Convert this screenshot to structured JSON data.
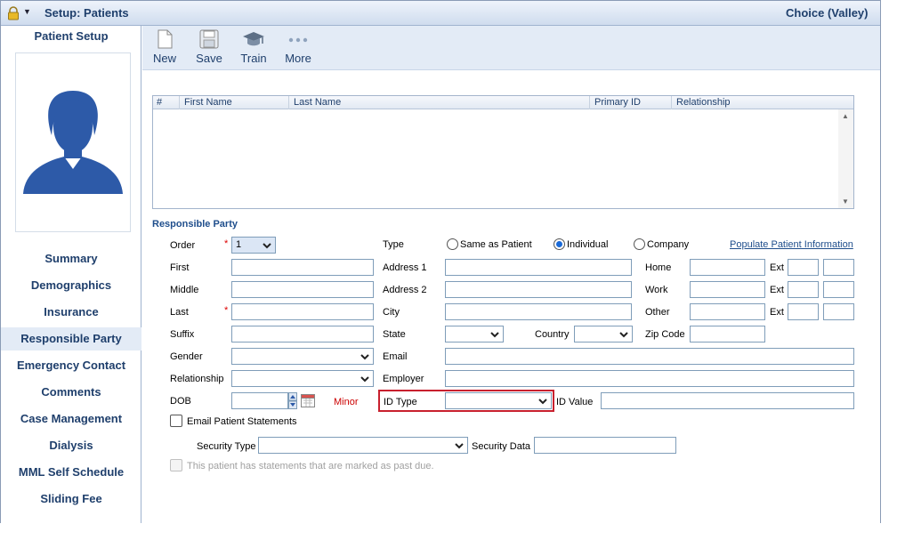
{
  "titlebar": {
    "title": "Setup: Patients",
    "org": "Choice (Valley)"
  },
  "sidebar": {
    "title": "Patient Setup",
    "items": [
      {
        "label": "Summary"
      },
      {
        "label": "Demographics"
      },
      {
        "label": "Insurance"
      },
      {
        "label": "Responsible Party",
        "active": true
      },
      {
        "label": "Emergency Contact"
      },
      {
        "label": "Comments"
      },
      {
        "label": "Case Management"
      },
      {
        "label": "Dialysis"
      },
      {
        "label": "MML Self Schedule"
      },
      {
        "label": "Sliding Fee"
      }
    ]
  },
  "toolbar": {
    "new": "New",
    "save": "Save",
    "train": "Train",
    "more": "More"
  },
  "grid": {
    "columns": [
      "#",
      "First Name",
      "Last Name",
      "Primary ID",
      "Relationship"
    ],
    "rows": []
  },
  "form": {
    "section_title": "Responsible Party",
    "order_label": "Order",
    "order_value": "1",
    "first_label": "First",
    "middle_label": "Middle",
    "last_label": "Last",
    "suffix_label": "Suffix",
    "gender_label": "Gender",
    "relationship_label": "Relationship",
    "dob_label": "DOB",
    "minor_label": "Minor",
    "type_label": "Type",
    "type_options": {
      "same": "Same as Patient",
      "individual": "Individual",
      "company": "Company",
      "selected": "Individual"
    },
    "populate_link": "Populate Patient Information",
    "address1_label": "Address 1",
    "address2_label": "Address 2",
    "city_label": "City",
    "state_label": "State",
    "country_label": "Country",
    "zip_label": "Zip Code",
    "email_label": "Email",
    "employer_label": "Employer",
    "id_type_label": "ID Type",
    "id_value_label": "ID Value",
    "home_label": "Home",
    "work_label": "Work",
    "other_label": "Other",
    "ext_label": "Ext",
    "email_statements_label": "Email Patient Statements",
    "security_type_label": "Security Type",
    "security_data_label": "Security Data",
    "past_due_label": "This patient has statements that are marked as past due."
  },
  "colors": {
    "accent": "#1f3f6c",
    "link": "#1f4e8c",
    "required": "#dd0000",
    "highlight": "#c8202e",
    "toolbar_bg": "#e3ebf6"
  }
}
